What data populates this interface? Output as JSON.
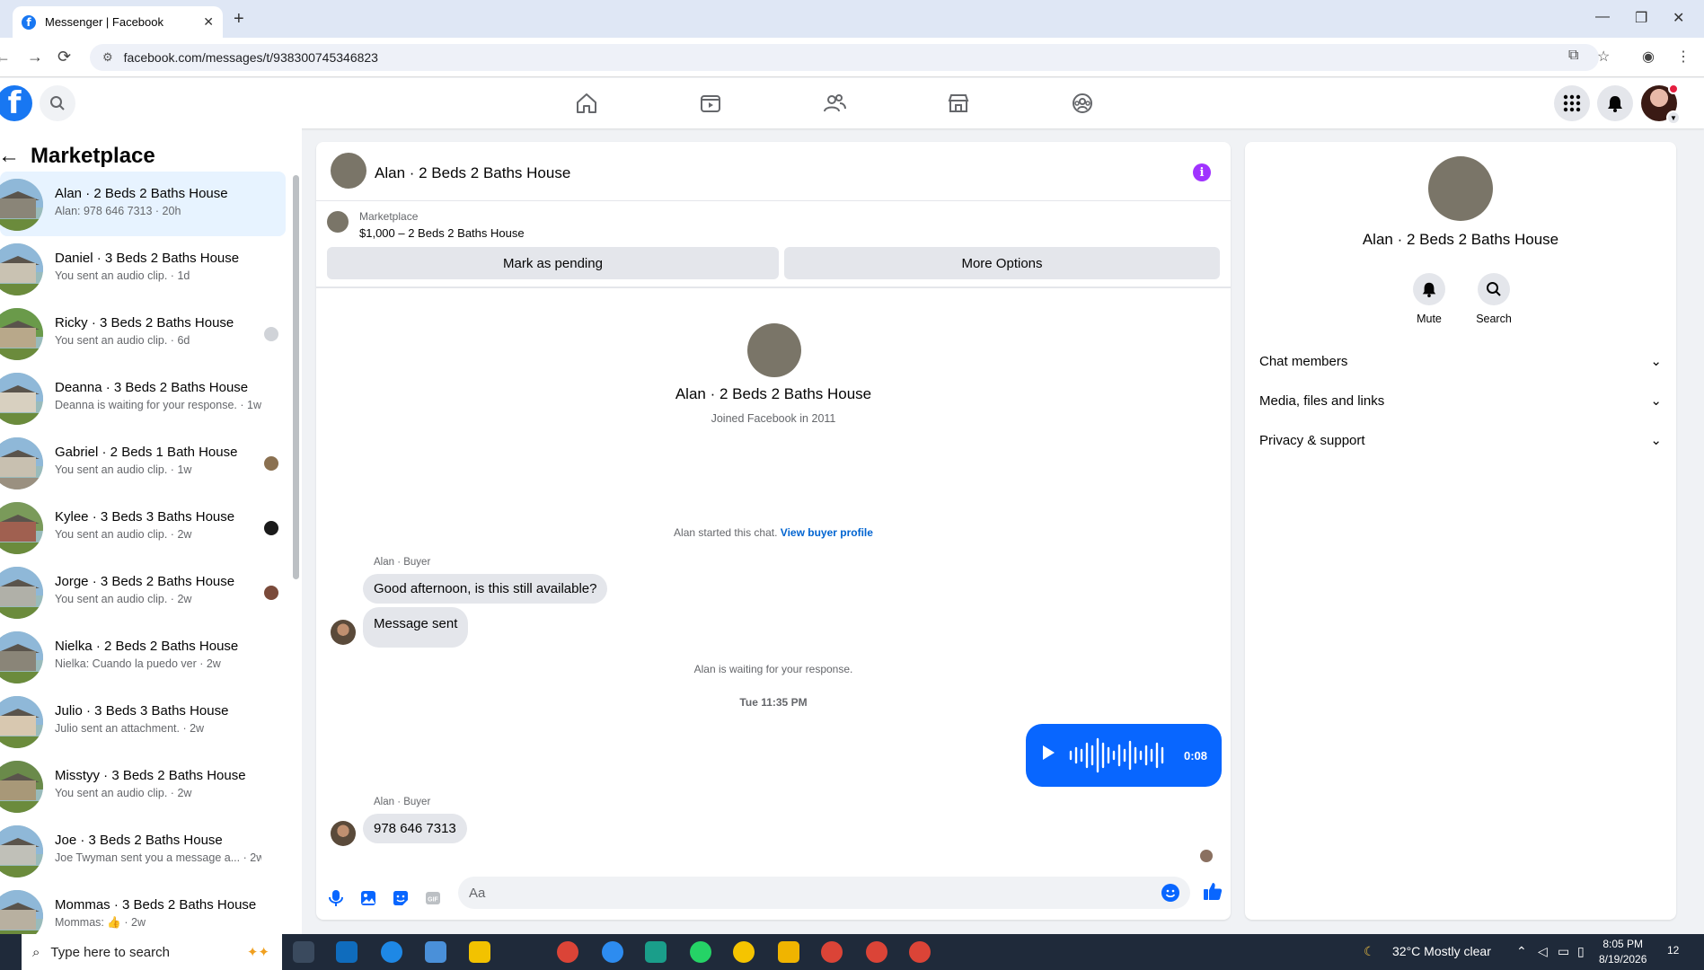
{
  "browser": {
    "tab_title": "Messenger | Facebook",
    "url": "facebook.com/messages/t/938300745346823"
  },
  "sidebar": {
    "title": "Marketplace",
    "conversations": [
      {
        "name": "Alan · 2 Beds 2 Baths House",
        "sub": "Alan: 978 646 7313 · 20h"
      },
      {
        "name": "Daniel · 3 Beds 2 Baths House",
        "sub": "You sent an audio clip. · 1d"
      },
      {
        "name": "Ricky · 3 Beds 2 Baths House",
        "sub": "You sent an audio clip. · 6d"
      },
      {
        "name": "Deanna · 3 Beds 2 Baths House",
        "sub": "Deanna is waiting for your response. · 1w"
      },
      {
        "name": "Gabriel · 2 Beds 1 Bath House",
        "sub": "You sent an audio clip. · 1w"
      },
      {
        "name": "Kylee · 3 Beds 3 Baths House",
        "sub": "You sent an audio clip. · 2w"
      },
      {
        "name": "Jorge · 3 Beds 2 Baths House",
        "sub": "You sent an audio clip. · 2w"
      },
      {
        "name": "Nielka · 2 Beds 2 Baths House",
        "sub": "Nielka: Cuando la puedo ver · 2w"
      },
      {
        "name": "Julio · 3 Beds 3 Baths House",
        "sub": "Julio sent an attachment. · 2w"
      },
      {
        "name": "Misstyy · 3 Beds 2 Baths House",
        "sub": "You sent an audio clip. · 2w"
      },
      {
        "name": "Joe · 3 Beds 2 Baths House",
        "sub": "Joe Twyman sent you a message a... · 2w"
      },
      {
        "name": "Mommas · 3 Beds 2 Baths House",
        "sub": "Mommas: 👍 · 2w"
      }
    ]
  },
  "chat": {
    "header_name": "Alan · 2 Beds 2 Baths House",
    "listing_source": "Marketplace",
    "listing_price": "$1,000 – 2 Beds 2 Baths House",
    "mark_pending_label": "Mark as pending",
    "more_options_label": "More Options",
    "intro_name": "Alan · 2 Beds 2 Baths House",
    "intro_sub": "Joined Facebook in 2011",
    "started_text": "Alan started this chat.",
    "view_profile_label": "View buyer profile",
    "sender_label_1": "Alan · Buyer",
    "msg_1": "Good afternoon, is this still available?",
    "msg_2": "Message sent",
    "waiting_text": "Alan is waiting for your response.",
    "timestamp": "Tue 11:35 PM",
    "audio_duration": "0:08",
    "sender_label_2": "Alan · Buyer",
    "msg_3": "978 646 7313",
    "composer_placeholder": "Aa"
  },
  "right_panel": {
    "name": "Alan · 2 Beds 2 Baths House",
    "mute_label": "Mute",
    "search_label": "Search",
    "sections": [
      "Chat members",
      "Media, files and links",
      "Privacy & support"
    ]
  },
  "taskbar": {
    "search_placeholder": "Type here to search",
    "weather": "32°C  Mostly clear",
    "time": "8:05 PM",
    "date": "8/19/2026",
    "notif_count": "12"
  },
  "colors": {
    "accent": "#0866ff",
    "fb_blue": "#1877f2",
    "info_purple": "#a033ff"
  }
}
